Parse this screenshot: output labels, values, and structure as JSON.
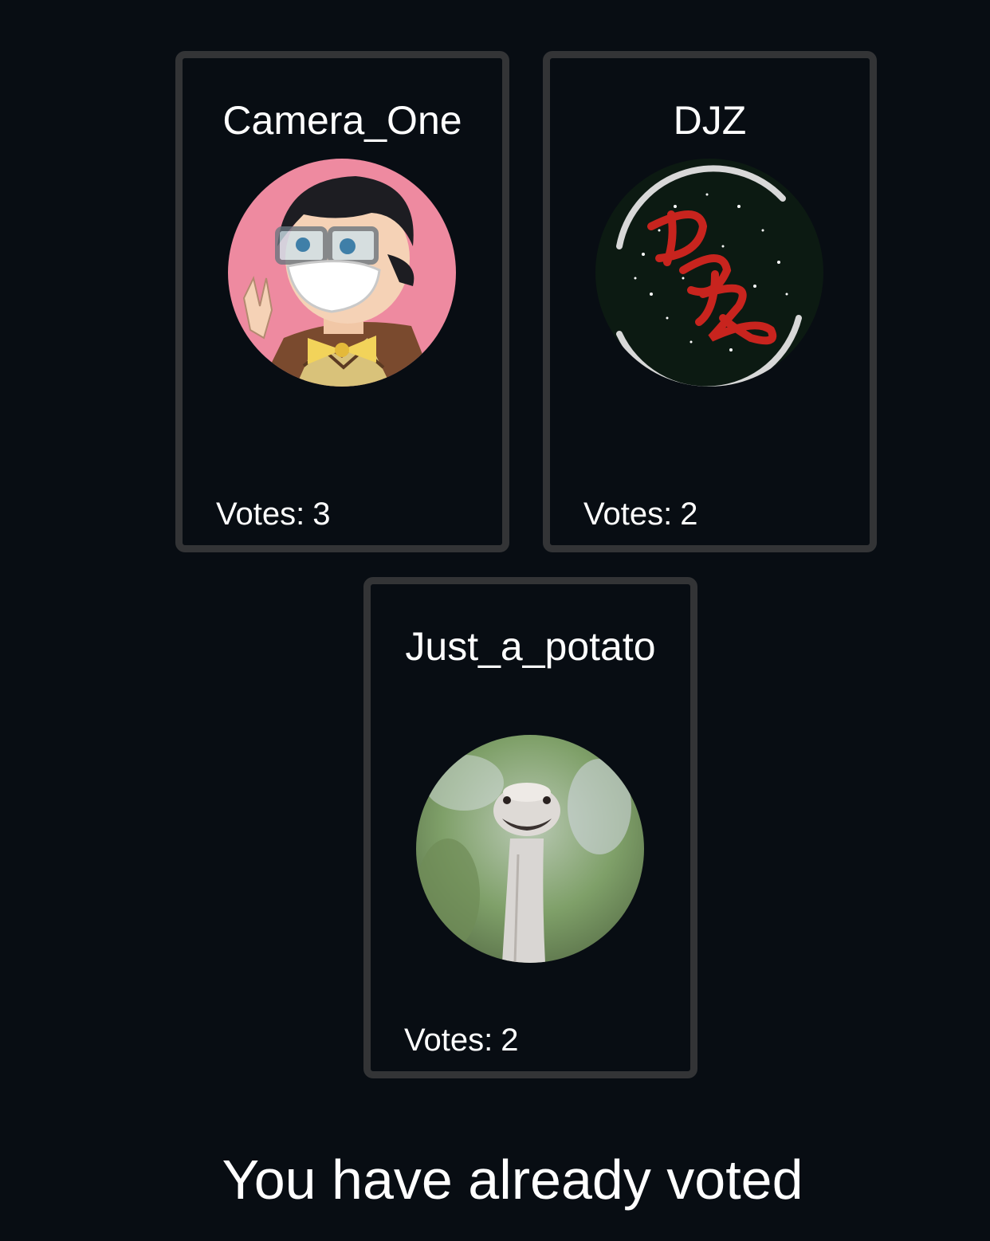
{
  "candidates": [
    {
      "name": "Camera_One",
      "votes_label": "Votes:",
      "votes": "3",
      "avatar": "anime-character-avatar"
    },
    {
      "name": "DJZ",
      "votes_label": "Votes:",
      "votes": "2",
      "avatar": "djz-logo-avatar"
    },
    {
      "name": "Just_a_potato",
      "votes_label": "Votes:",
      "votes": "2",
      "avatar": "ostrich-photo-avatar"
    }
  ],
  "status_message": "You have already voted",
  "colors": {
    "background": "#080d13",
    "card_border": "#333436",
    "text": "#ffffff"
  }
}
